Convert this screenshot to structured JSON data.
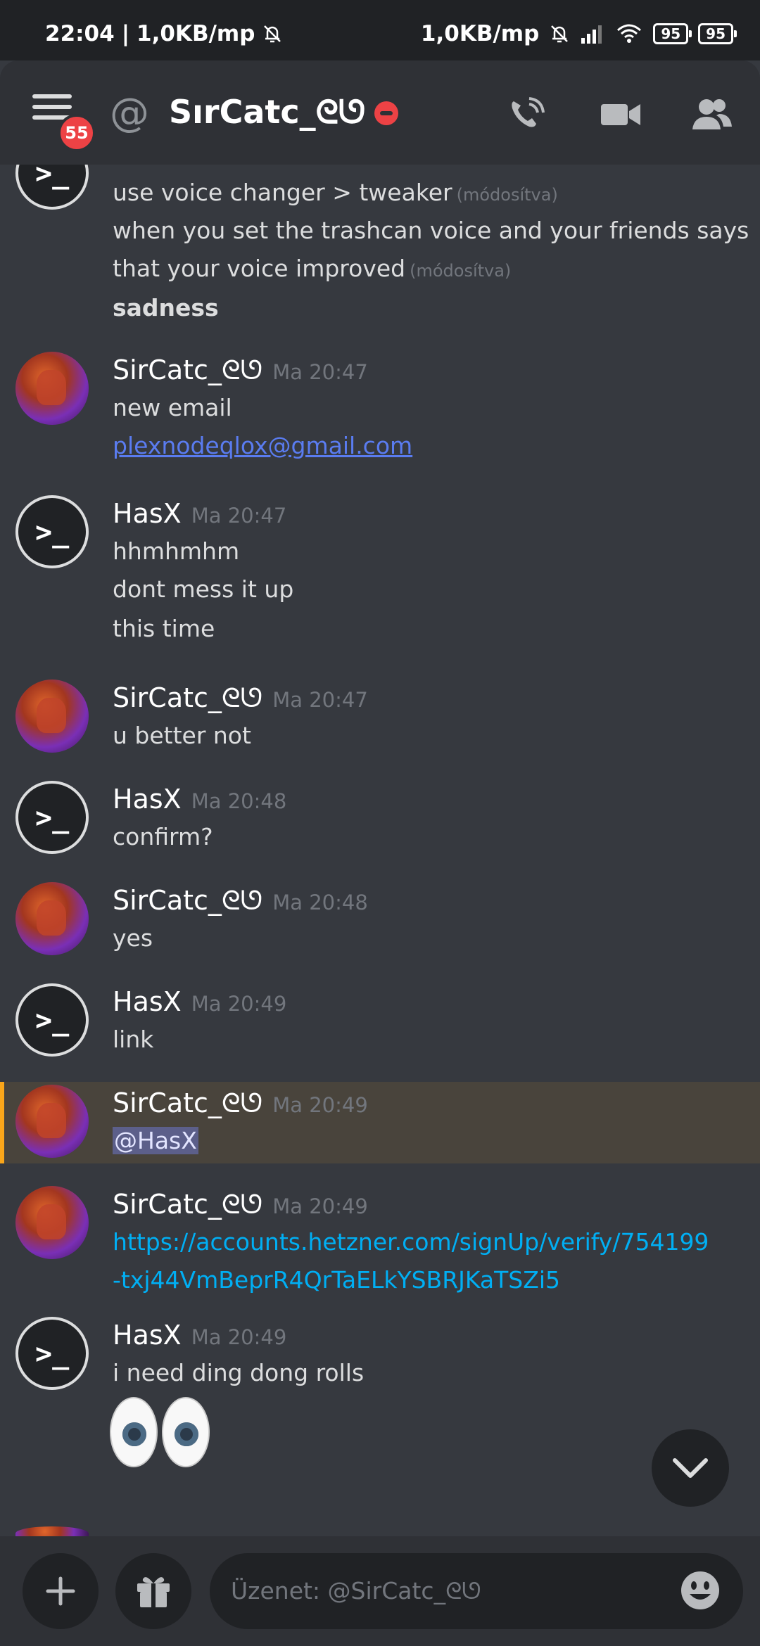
{
  "status_bar": {
    "time": "22:04",
    "speed_left": "1,0KB/mp",
    "speed_right": "1,0KB/mp",
    "battery": "95"
  },
  "header": {
    "notification_count": "55",
    "channel_name": "SırCatc_ᘓᘎ"
  },
  "messages": [
    {
      "lines": [
        {
          "text": "use voice changer > tweaker",
          "edited": "(módosítva)"
        },
        {
          "text": "when you set the trashcan voice and your friends says"
        },
        {
          "text": "that your voice improved",
          "edited": "(módosítva)"
        },
        {
          "text": "sadness"
        }
      ]
    },
    {
      "author": "SirCatc_ᘓᘎ",
      "time": "Ma 20:47",
      "lines": [
        {
          "text": "new email"
        },
        {
          "text": "plexnodeqlox@gmail.com"
        }
      ]
    },
    {
      "author": "HasX",
      "time": "Ma 20:47",
      "lines": [
        {
          "text": "hhmhmhm"
        },
        {
          "text": "dont mess it up"
        },
        {
          "text": "this time"
        }
      ]
    },
    {
      "author": "SirCatc_ᘓᘎ",
      "time": "Ma 20:47",
      "lines": [
        {
          "text": "u better not"
        }
      ]
    },
    {
      "author": "HasX",
      "time": "Ma 20:48",
      "lines": [
        {
          "text": "confirm?"
        }
      ]
    },
    {
      "author": "SirCatc_ᘓᘎ",
      "time": "Ma 20:48",
      "lines": [
        {
          "text": "yes"
        }
      ]
    },
    {
      "author": "HasX",
      "time": "Ma 20:49",
      "lines": [
        {
          "text": "link"
        }
      ]
    },
    {
      "author": "SirCatc_ᘓᘎ",
      "time": "Ma 20:49",
      "lines": [
        {
          "text": "@HasX"
        }
      ]
    },
    {
      "author": "SirCatc_ᘓᘎ",
      "time": "Ma 20:49",
      "lines": [
        {
          "text": "https://accounts.hetzner.com/signUp/verify/754199"
        },
        {
          "text": "-txj44VmBeprR4QrTaELkYSBRJKaTSZi5"
        }
      ]
    },
    {
      "author": "HasX",
      "time": "Ma 20:49",
      "lines": [
        {
          "text": "i need ding dong rolls"
        }
      ]
    }
  ],
  "input": {
    "placeholder": "Üzenet: @SirCatc_ᘓᘎ"
  },
  "icons": {
    "terminal_prompt": ">_"
  },
  "colors": {
    "mention_highlight": "#faa61a",
    "link": "#00aff4",
    "dnd": "#ed4245"
  }
}
